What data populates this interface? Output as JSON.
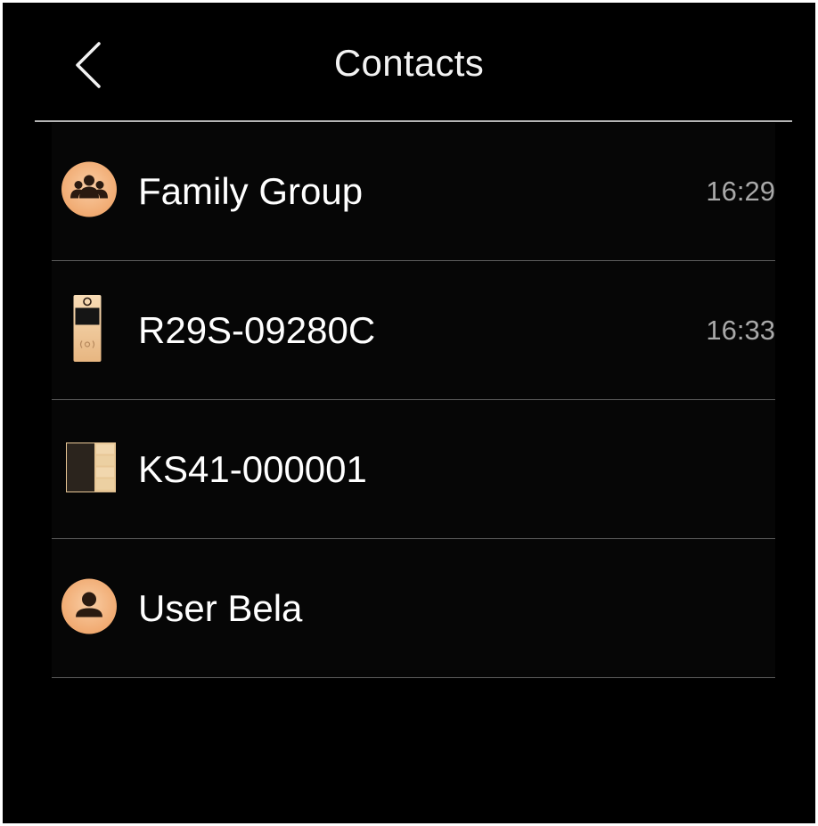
{
  "header": {
    "title": "Contacts",
    "back_icon": "chevron-left-icon"
  },
  "colors": {
    "background": "#000000",
    "text_primary": "#ffffff",
    "text_secondary": "#a9a9a9",
    "accent": "#f3b889",
    "divider": "#5d5d5d"
  },
  "contacts": [
    {
      "name": "Family Group",
      "time": "16:29",
      "icon": "group-icon"
    },
    {
      "name": "R29S-09280C",
      "time": "16:33",
      "icon": "door-phone-icon"
    },
    {
      "name": "KS41-000001",
      "time": "",
      "icon": "keypad-panel-icon"
    },
    {
      "name": "User Bela",
      "time": "",
      "icon": "user-icon"
    }
  ]
}
